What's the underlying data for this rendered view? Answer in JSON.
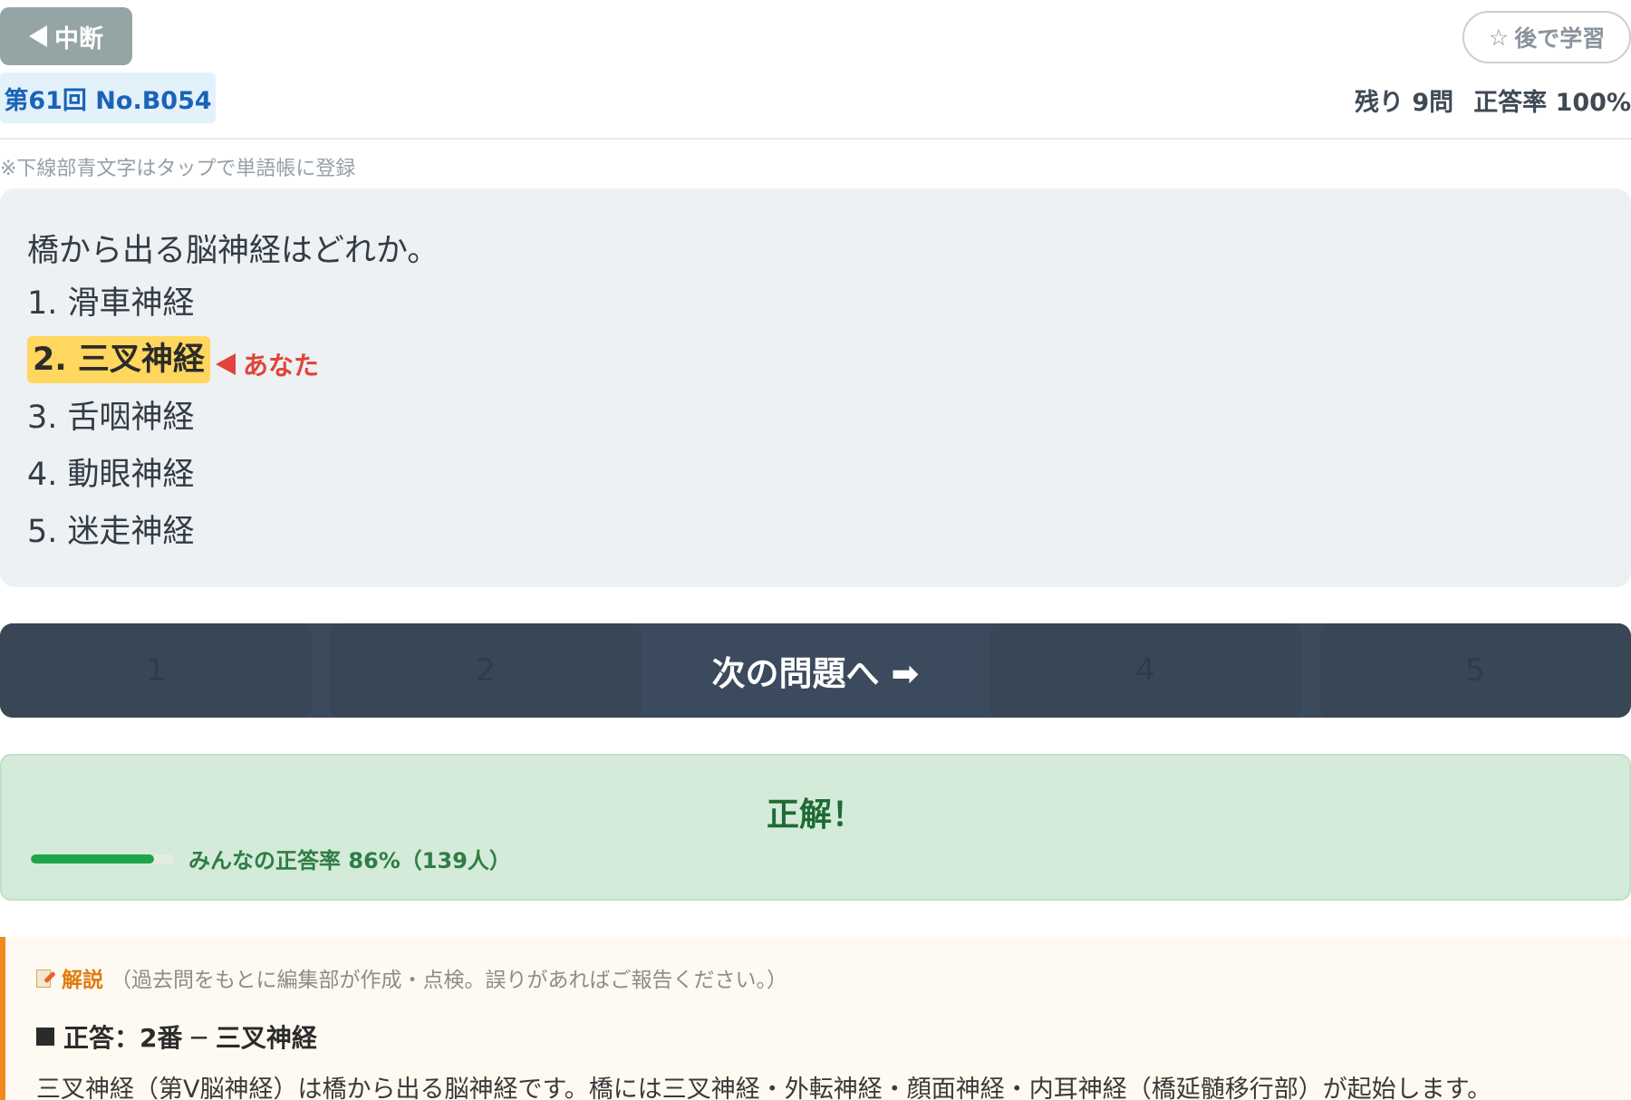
{
  "header": {
    "abort_label": "中断",
    "later_label": "後で学習",
    "exam_label": "第61回 No.B054",
    "remaining": "残り 9問",
    "accuracy": "正答率 100%"
  },
  "note": "※下線部青文字はタップで単語帳に登録",
  "question": {
    "text": "橋から出る脳神経はどれか。",
    "choices": [
      "1. 滑車神経",
      "2. 三叉神経",
      "3. 舌咽神経",
      "4. 動眼神経",
      "5. 迷走神経"
    ],
    "selected_index": 1,
    "you_label": "あなた"
  },
  "action_bar": {
    "ghost_labels": [
      "1",
      "2",
      "4",
      "5"
    ],
    "next_label": "次の問題へ ➡"
  },
  "result": {
    "title": "正解！",
    "everyone_rate": 0.86,
    "rate_text": "みんなの正答率 86%（139人）",
    "bar_color": "#1fa64a"
  },
  "explanation": {
    "label": "解説",
    "sub": "（過去問をもとに編集部が作成・点検。誤りがあればご報告ください。）",
    "answer": "正答：2番 ─ 三叉神経",
    "body": "三叉神経（第V脳神経）は橋から出る脳神経です。橋には三叉神経・外転神経・顔面神経・内耳神経（橋延髄移行部）が起始します。"
  },
  "colors": {
    "accent": "#3b4a5c",
    "highlight": "#ffd75e",
    "you_marker": "#e0443a",
    "correct_bg": "#d4ebd9",
    "explain_accent": "#f08a1c"
  },
  "icons": [
    "back-triangle-icon",
    "star-icon",
    "memo-icon",
    "square-icon",
    "right-arrow-icon"
  ]
}
